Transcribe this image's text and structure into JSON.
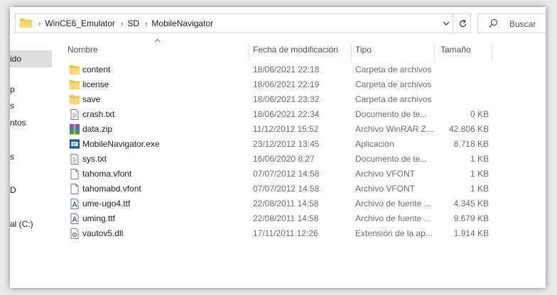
{
  "address_bar": {
    "crumbs": [
      "WinCE6_Emulator",
      "SD",
      "MobileNavigator"
    ],
    "separator": "›",
    "dropdown_icon": "chevron-down-icon",
    "refresh_icon": "refresh-icon"
  },
  "search": {
    "placeholder": "Buscar",
    "icon": "search-icon"
  },
  "nav_pane": {
    "items": [
      {
        "label": "ido",
        "selected": true
      },
      {
        "label": "p"
      },
      {
        "label": "s"
      },
      {
        "label": "ntos"
      },
      {
        "label": "s"
      },
      {
        "label": "D"
      },
      {
        "label": "al (C:)"
      }
    ]
  },
  "columns": {
    "name": "Nombre",
    "date": "Fecha de modificación",
    "type": "Tipo",
    "size": "Tamaño"
  },
  "files": [
    {
      "name": "content",
      "date": "18/06/2021 22:18",
      "type": "Carpeta de archivos",
      "size": "",
      "icon": "folder-icon"
    },
    {
      "name": "license",
      "date": "18/06/2021 22:19",
      "type": "Carpeta de archivos",
      "size": "",
      "icon": "folder-icon"
    },
    {
      "name": "save",
      "date": "18/06/2021 23:32",
      "type": "Carpeta de archivos",
      "size": "",
      "icon": "folder-icon"
    },
    {
      "name": "crash.txt",
      "date": "18/06/2021 22:34",
      "type": "Documento de te...",
      "size": "0 KB",
      "icon": "text-file-icon"
    },
    {
      "name": "data.zip",
      "date": "11/12/2012 15:52",
      "type": "Archivo WinRAR Z...",
      "size": "42.806 KB",
      "icon": "winrar-archive-icon"
    },
    {
      "name": "MobileNavigator.exe",
      "date": "23/12/2012 13:45",
      "type": "Aplicación",
      "size": "8.718 KB",
      "icon": "app-exe-icon"
    },
    {
      "name": "sys.txt",
      "date": "16/06/2020 8:27",
      "type": "Documento de te...",
      "size": "1 KB",
      "icon": "text-file-icon"
    },
    {
      "name": "tahoma.vfont",
      "date": "07/07/2012 14:58",
      "type": "Archivo VFONT",
      "size": "1 KB",
      "icon": "blank-file-icon"
    },
    {
      "name": "tahomabd.vfont",
      "date": "07/07/2012 14:58",
      "type": "Archivo VFONT",
      "size": "1 KB",
      "icon": "blank-file-icon"
    },
    {
      "name": "ume-ugo4.ttf",
      "date": "22/08/2011 14:58",
      "type": "Archivo de fuente ...",
      "size": "4.345 KB",
      "icon": "font-file-icon"
    },
    {
      "name": "uming.ttf",
      "date": "22/08/2011 14:58",
      "type": "Archivo de fuente ...",
      "size": "9.679 KB",
      "icon": "font-file-icon"
    },
    {
      "name": "vautov5.dll",
      "date": "17/11/2011 12:26",
      "type": "Extensión de la ap...",
      "size": "1.914 KB",
      "icon": "dll-file-icon"
    }
  ]
}
